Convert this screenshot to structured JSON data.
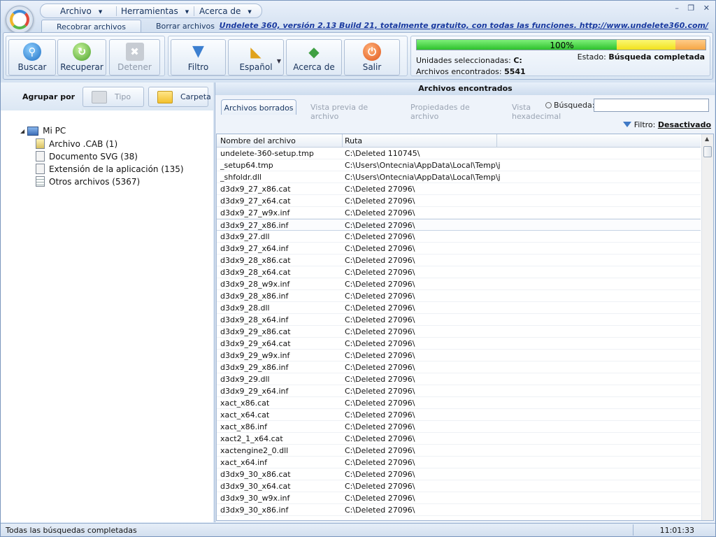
{
  "menu": {
    "archivo": "Archivo",
    "herramientas": "Herramientas",
    "acerca": "Acerca de"
  },
  "window_controls": {
    "minimize": "–",
    "restore": "❐",
    "close": "✕"
  },
  "ribbon_tabs": {
    "recobrar": "Recobrar archivos",
    "borrar": "Borrar archivos"
  },
  "promo_link": "Undelete 360, versión 2.13 Build 21, totalmente gratuito, con todas las funciones. http://www.undelete360.com/",
  "toolbar": {
    "buscar": "Buscar",
    "recuperar": "Recuperar",
    "detener": "Detener",
    "filtro": "Filtro",
    "espanol": "Español",
    "acerca": "Acerca de",
    "salir": "Salir"
  },
  "status_panel": {
    "progress_percent": 100,
    "progress_text": "100%",
    "units_label": "Unidades seleccionadas:",
    "units_value": "C:",
    "files_label": "Archivos encontrados:",
    "files_value": "5541",
    "state_label": "Estado:",
    "state_value": "Búsqueda completada"
  },
  "group": {
    "label": "Agrupar por",
    "tipo": "Tipo",
    "carpeta": "Carpeta"
  },
  "tree": {
    "root": "Mi PC",
    "items": [
      "Archivo .CAB (1)",
      "Documento SVG (38)",
      "Extensión de la aplicación (135)",
      "Otros archivos (5367)"
    ]
  },
  "results": {
    "header": "Archivos encontrados",
    "tabs": [
      "Archivos borrados",
      "Vista previa de archivo",
      "Propiedades de archivo",
      "Vista hexadecimal"
    ],
    "search_label": "Búsqueda:",
    "search_value": "",
    "filter_label": "Filtro:",
    "filter_value": "Desactivado",
    "columns": [
      "Nombre del archivo",
      "Ruta"
    ],
    "rows": [
      [
        "undelete-360-setup.tmp",
        "C:\\Deleted 110745\\"
      ],
      [
        "_setup64.tmp",
        "C:\\Users\\Ontecnia\\AppData\\Local\\Temp\\js..."
      ],
      [
        "_shfoldr.dll",
        "C:\\Users\\Ontecnia\\AppData\\Local\\Temp\\js..."
      ],
      [
        "d3dx9_27_x86.cat",
        "C:\\Deleted 27096\\"
      ],
      [
        "d3dx9_27_x64.cat",
        "C:\\Deleted 27096\\"
      ],
      [
        "d3dx9_27_w9x.inf",
        "C:\\Deleted 27096\\"
      ],
      [
        "d3dx9_27_x86.inf",
        "C:\\Deleted 27096\\"
      ],
      [
        "d3dx9_27.dll",
        "C:\\Deleted 27096\\"
      ],
      [
        "d3dx9_27_x64.inf",
        "C:\\Deleted 27096\\"
      ],
      [
        "d3dx9_28_x86.cat",
        "C:\\Deleted 27096\\"
      ],
      [
        "d3dx9_28_x64.cat",
        "C:\\Deleted 27096\\"
      ],
      [
        "d3dx9_28_w9x.inf",
        "C:\\Deleted 27096\\"
      ],
      [
        "d3dx9_28_x86.inf",
        "C:\\Deleted 27096\\"
      ],
      [
        "d3dx9_28.dll",
        "C:\\Deleted 27096\\"
      ],
      [
        "d3dx9_28_x64.inf",
        "C:\\Deleted 27096\\"
      ],
      [
        "d3dx9_29_x86.cat",
        "C:\\Deleted 27096\\"
      ],
      [
        "d3dx9_29_x64.cat",
        "C:\\Deleted 27096\\"
      ],
      [
        "d3dx9_29_w9x.inf",
        "C:\\Deleted 27096\\"
      ],
      [
        "d3dx9_29_x86.inf",
        "C:\\Deleted 27096\\"
      ],
      [
        "d3dx9_29.dll",
        "C:\\Deleted 27096\\"
      ],
      [
        "d3dx9_29_x64.inf",
        "C:\\Deleted 27096\\"
      ],
      [
        "xact_x86.cat",
        "C:\\Deleted 27096\\"
      ],
      [
        "xact_x64.cat",
        "C:\\Deleted 27096\\"
      ],
      [
        "xact_x86.inf",
        "C:\\Deleted 27096\\"
      ],
      [
        "xact2_1_x64.cat",
        "C:\\Deleted 27096\\"
      ],
      [
        "xactengine2_0.dll",
        "C:\\Deleted 27096\\"
      ],
      [
        "xact_x64.inf",
        "C:\\Deleted 27096\\"
      ],
      [
        "d3dx9_30_x86.cat",
        "C:\\Deleted 27096\\"
      ],
      [
        "d3dx9_30_x64.cat",
        "C:\\Deleted 27096\\"
      ],
      [
        "d3dx9_30_w9x.inf",
        "C:\\Deleted 27096\\"
      ],
      [
        "d3dx9_30_x86.inf",
        "C:\\Deleted 27096\\"
      ]
    ]
  },
  "statusbar": {
    "message": "Todas las búsquedas completadas",
    "time": "11:01:33"
  }
}
